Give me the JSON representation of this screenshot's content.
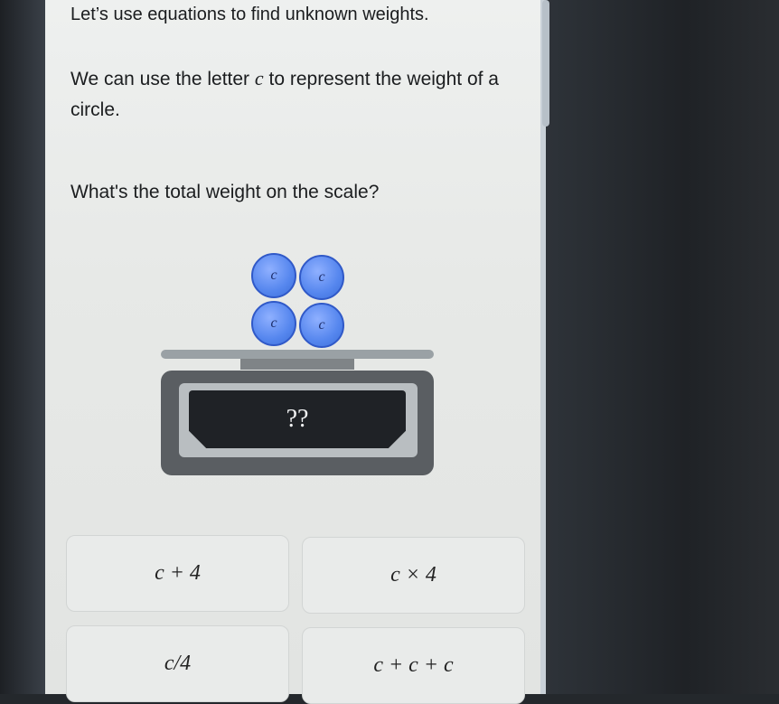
{
  "lesson": {
    "title": "Let’s use equations to find unknown weights.",
    "intro_part1": "We can use the letter ",
    "variable": "c",
    "intro_part2": " to represent the weight of a circle.",
    "question": "What's the total weight on the scale?"
  },
  "scale": {
    "circle_labels": [
      "c",
      "c",
      "c",
      "c"
    ],
    "display_value": "??"
  },
  "options": [
    {
      "label": "c + 4"
    },
    {
      "label": "c × 4"
    },
    {
      "label": "c/4"
    },
    {
      "label": "c + c + c"
    }
  ]
}
